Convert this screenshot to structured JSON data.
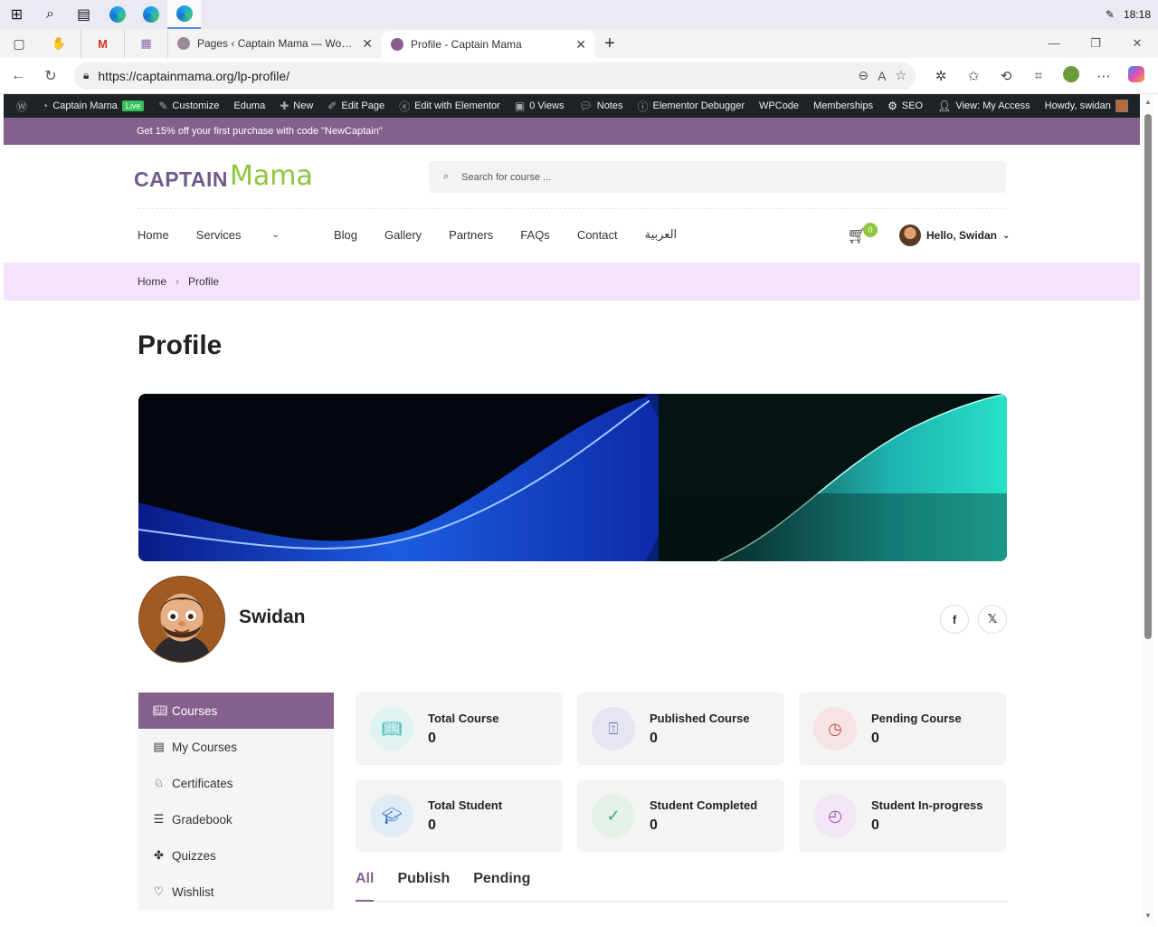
{
  "taskbar": {
    "time": "18:18"
  },
  "browser": {
    "tabs": [
      {
        "label": "Pages ‹ Captain Mama — WordPress"
      },
      {
        "label": "Profile - Captain Mama"
      }
    ],
    "url": "https://captainmama.org/lp-profile/"
  },
  "wp_admin_bar": {
    "site": "Captain Mama",
    "live": "Live",
    "customize": "Customize",
    "theme": "Eduma",
    "new": "New",
    "edit_page": "Edit Page",
    "elementor": "Edit with Elementor",
    "views": "0 Views",
    "notes": "Notes",
    "debugger": "Elementor Debugger",
    "wpcode": "WPCode",
    "memberships": "Memberships",
    "seo": "SEO",
    "view_access": "View: My Access",
    "howdy": "Howdy, swidan"
  },
  "promo": "Get 15% off your first purchase with code \"NewCaptain\"",
  "header": {
    "logo_left": "CAPTAIN",
    "logo_right": "Mama",
    "search_placeholder": "Search for course ...",
    "menu": [
      "Home",
      "Services",
      "Blog",
      "Gallery",
      "Partners",
      "FAQs",
      "Contact",
      "العربية"
    ],
    "cart_count": "0",
    "user_greeting": "Hello, Swidan"
  },
  "breadcrumb": [
    "Home",
    "Profile"
  ],
  "page_title": "Profile",
  "profile": {
    "name": "Swidan"
  },
  "sidebar": [
    {
      "label": "Courses"
    },
    {
      "label": "My Courses"
    },
    {
      "label": "Certificates"
    },
    {
      "label": "Gradebook"
    },
    {
      "label": "Quizzes"
    },
    {
      "label": "Wishlist"
    }
  ],
  "stats": [
    {
      "label": "Total Course",
      "value": "0",
      "color": "#2fb3b3",
      "bg": "#e0f3f3"
    },
    {
      "label": "Published Course",
      "value": "0",
      "color": "#6f6fb5",
      "bg": "#e6e6f3"
    },
    {
      "label": "Pending Course",
      "value": "0",
      "color": "#d04a4a",
      "bg": "#f6e3e3"
    },
    {
      "label": "Total Student",
      "value": "0",
      "color": "#2d6fc2",
      "bg": "#e1ebf6"
    },
    {
      "label": "Student Completed",
      "value": "0",
      "color": "#3da55a",
      "bg": "#e2f2e6"
    },
    {
      "label": "Student In-progress",
      "value": "0",
      "color": "#a050b0",
      "bg": "#f2e5f5"
    }
  ],
  "course_tabs": [
    "All",
    "Publish",
    "Pending"
  ],
  "colors": {
    "accent": "#86608d",
    "breadcrumb_bg": "#f6e3fb",
    "logo_green": "#8cc63f",
    "admin_bar": "#1d2327"
  }
}
